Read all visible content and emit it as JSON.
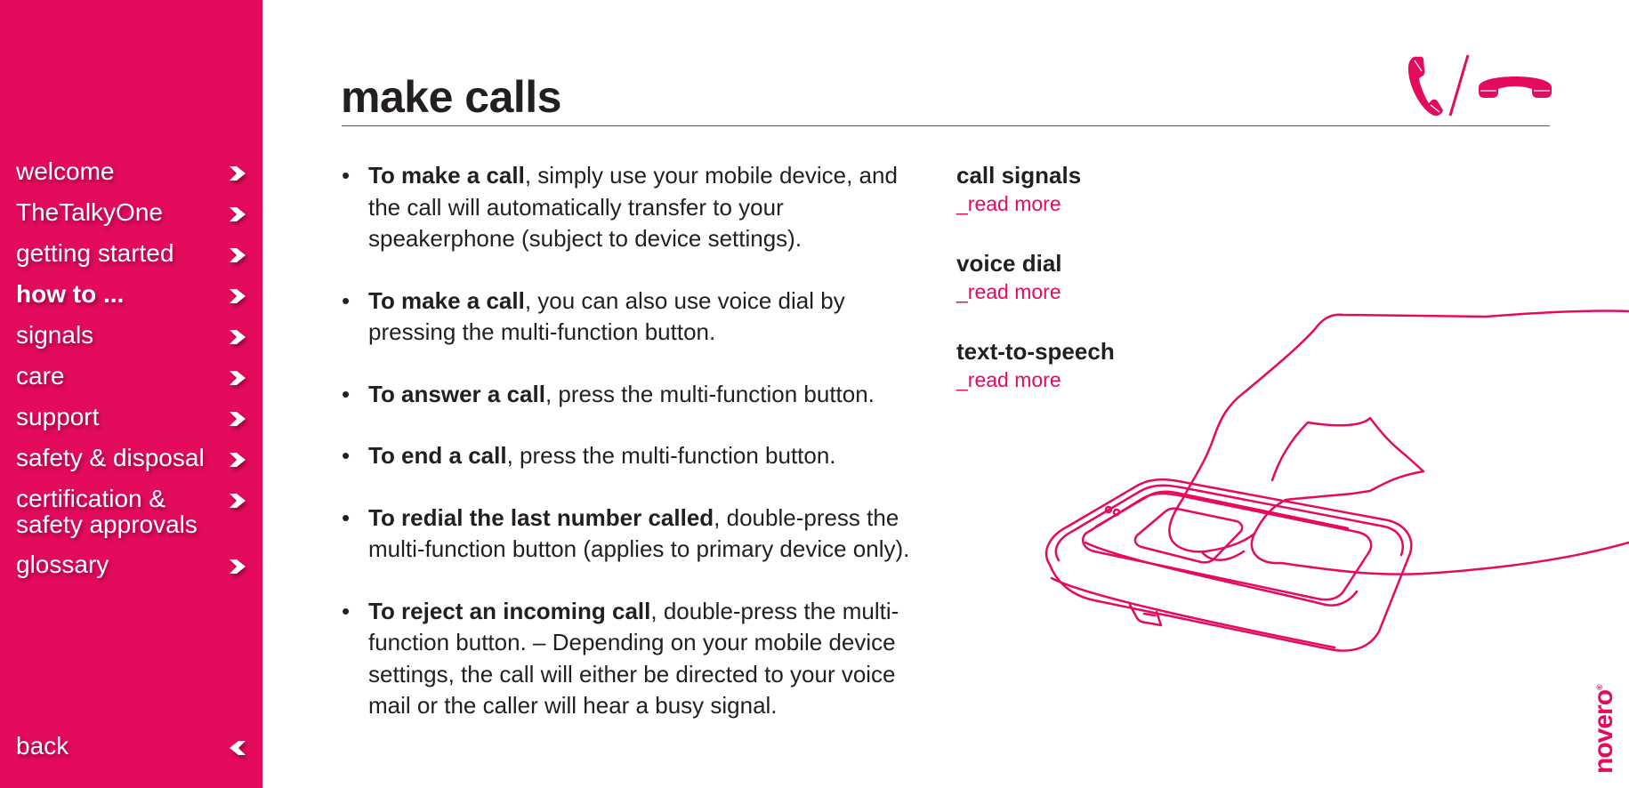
{
  "sidebar": {
    "items": [
      {
        "label": "welcome",
        "active": false
      },
      {
        "label": "TheTalkyOne",
        "active": false
      },
      {
        "label": "getting started",
        "active": false
      },
      {
        "label": "how to ...",
        "active": true
      },
      {
        "label": "signals",
        "active": false
      },
      {
        "label": "care",
        "active": false
      },
      {
        "label": "support",
        "active": false
      },
      {
        "label": "safety & disposal",
        "active": false
      },
      {
        "label": "certification & safety approvals",
        "active": false
      },
      {
        "label": "glossary",
        "active": false
      }
    ],
    "back_label": "back",
    "icons": {
      "forward": "chevron-right-icon",
      "back": "chevron-left-icon"
    }
  },
  "page": {
    "title": "make calls",
    "header_icons": [
      "phone-pickup-icon",
      "slash-divider",
      "phone-hangup-icon"
    ]
  },
  "bullets": [
    {
      "bold": "To make a call",
      "text": ", simply use your mobile device, and the call will automatically transfer to your speakerphone (subject to device settings)."
    },
    {
      "bold": "To make a call",
      "text": ", you can also use voice dial by pressing the multi-function button."
    },
    {
      "bold": "To answer a call",
      "text": ", press the multi-function button."
    },
    {
      "bold": "To end a call",
      "text": ", press the multi-function button."
    },
    {
      "bold": "To redial the last number called",
      "text": ", double-press the multi-function button (applies to primary device only)."
    },
    {
      "bold": "To reject an incoming call",
      "text": ", double-press the multi-function button. – Depending on your mobile device settings, the call will either be directed to your voice mail or the caller will hear a busy signal."
    }
  ],
  "related": [
    {
      "heading": "call signals",
      "link": "_read more"
    },
    {
      "heading": "voice dial",
      "link": "_read more"
    },
    {
      "heading": "text-to-speech",
      "link": "_read more"
    }
  ],
  "brand": {
    "logo": "novero",
    "registered": "®"
  },
  "colors": {
    "accent": "#e40b5f",
    "text": "#231f20",
    "background": "#ffffff"
  }
}
